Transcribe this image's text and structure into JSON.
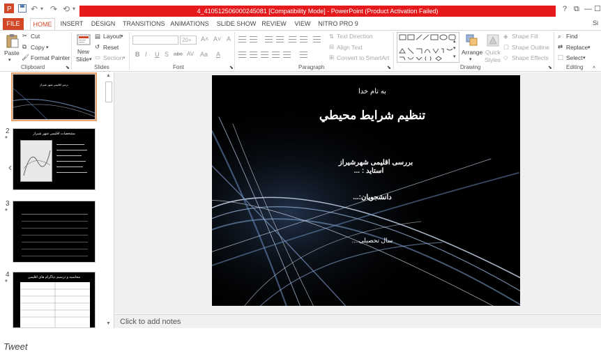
{
  "titlebar": {
    "title": "4_410512506000245081 [Compatibility Mode] - PowerPoint (Product Activation Failed)",
    "help": "?",
    "controls": [
      "⧉",
      "—",
      "☐",
      "✕"
    ]
  },
  "tabs": [
    {
      "label": "FILE"
    },
    {
      "label": "HOME"
    },
    {
      "label": "INSERT"
    },
    {
      "label": "DESIGN"
    },
    {
      "label": "TRANSITIONS"
    },
    {
      "label": "ANIMATIONS"
    },
    {
      "label": "SLIDE SHOW"
    },
    {
      "label": "REVIEW"
    },
    {
      "label": "VIEW"
    },
    {
      "label": "NITRO PRO 9"
    }
  ],
  "user_initial": "Si",
  "ribbon": {
    "clipboard": {
      "paste": "Paste",
      "cut": "Cut",
      "copy": "Copy",
      "format_painter": "Format Painter",
      "label": "Clipboard"
    },
    "slides": {
      "new_slide": "New",
      "new_slide2": "Slide",
      "layout": "Layout",
      "reset": "Reset",
      "section": "Section",
      "label": "Slides"
    },
    "font": {
      "size": "20+",
      "bold": "B",
      "italic": "I",
      "underline": "U",
      "strike": "S",
      "shadow": "abc",
      "spacing": "AV",
      "case": "Aa",
      "color": "A",
      "label": "Font"
    },
    "paragraph": {
      "text_direction": "Text Direction",
      "align_text": "Align Text",
      "smartart": "Convert to SmartArt",
      "label": "Paragraph"
    },
    "drawing": {
      "arrange": "Arrange",
      "quick_styles": "Quick",
      "quick_styles2": "Styles",
      "shape_fill": "Shape Fill",
      "shape_outline": "Shape Outline",
      "shape_effects": "Shape Effects",
      "label": "Drawing"
    },
    "editing": {
      "find": "Find",
      "replace": "Replace",
      "select": "Select",
      "label": "Editing"
    }
  },
  "slides": [
    {
      "num": "",
      "title": "برمی اقلیمی شهر شیراز"
    },
    {
      "num": "2",
      "title": "مشخصات اقلیمی شهر شیراز"
    },
    {
      "num": "3",
      "title": ""
    },
    {
      "num": "4",
      "title": "محاسبه و ترسیم دیاگرام های اقلیمی"
    }
  ],
  "slide": {
    "line1": "به نام خدا",
    "title": "تنظیم شرایط محیطي",
    "subject": "بررسی اقلیمی شهرشیراز",
    "teacher": "استاید : ...",
    "students": "دانشجویان:...",
    "year": "سال تحصیلی...."
  },
  "notes_placeholder": "Click to add notes",
  "tweet": "Tweet"
}
